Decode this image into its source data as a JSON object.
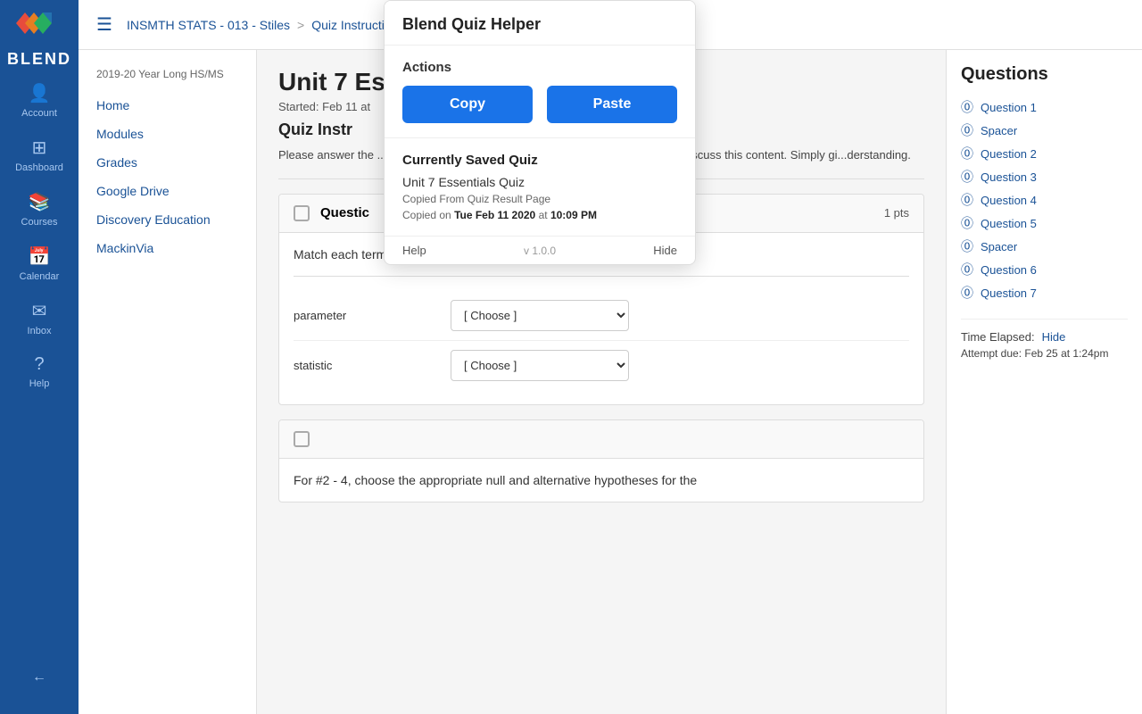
{
  "sidebar": {
    "logo_text": "BLEND",
    "items": [
      {
        "id": "account",
        "label": "Account",
        "icon": "👤"
      },
      {
        "id": "dashboard",
        "label": "Dashboard",
        "icon": "⊞"
      },
      {
        "id": "courses",
        "label": "Courses",
        "icon": "📚"
      },
      {
        "id": "calendar",
        "label": "Calendar",
        "icon": "📅"
      },
      {
        "id": "inbox",
        "label": "Inbox",
        "icon": "✉"
      },
      {
        "id": "help",
        "label": "Help",
        "icon": "?"
      }
    ],
    "collapse_icon": "←"
  },
  "topnav": {
    "breadcrumb_course": "INSMTH STATS - 013 - Stiles",
    "breadcrumb_sep": ">",
    "breadcrumb_current": "Quiz Instructions"
  },
  "left_nav": {
    "year_label": "2019-20 Year Long HS/MS",
    "links": [
      {
        "label": "Home"
      },
      {
        "label": "Modules"
      },
      {
        "label": "Grades"
      },
      {
        "label": "Google Drive"
      },
      {
        "label": "Discovery Education"
      },
      {
        "label": "MackinVia"
      }
    ]
  },
  "quiz": {
    "title": "Unit 7 Ess",
    "started": "Started: Feb 11 at",
    "instructions_title": "Quiz Instr",
    "instructions_text": "Please answer the ...eet, t-table and a calculator.\nI encourage you to ...roughly discuss this\ncontent.  Simply gi...derstanding."
  },
  "question1": {
    "label": "Questic",
    "pts": "1 pts",
    "text": "Match each term with its definition.",
    "rows": [
      {
        "term": "parameter",
        "placeholder": "[ Choose ]"
      },
      {
        "term": "statistic",
        "placeholder": "[ Choose ]"
      }
    ]
  },
  "question2": {
    "text": "For #2 - 4, choose the appropriate null and alternative hypotheses for the"
  },
  "right_panel": {
    "title": "Questions",
    "items": [
      {
        "label": "Question 1"
      },
      {
        "label": "Spacer"
      },
      {
        "label": "Question 2"
      },
      {
        "label": "Question 3"
      },
      {
        "label": "Question 4"
      },
      {
        "label": "Question 5"
      },
      {
        "label": "Spacer"
      },
      {
        "label": "Question 6"
      },
      {
        "label": "Question 7"
      }
    ],
    "time_elapsed_label": "Time Elapsed:",
    "hide_label": "Hide",
    "attempt_due": "Attempt due: Feb 25 at 1:24pm"
  },
  "quiz_helper": {
    "title": "Blend Quiz Helper",
    "actions_label": "Actions",
    "copy_btn": "Copy",
    "paste_btn": "Paste",
    "saved_quiz_title": "Currently Saved Quiz",
    "saved_quiz_name": "Unit 7 Essentials Quiz",
    "saved_quiz_source": "Copied From Quiz Result Page",
    "saved_quiz_date_prefix": "Copied on",
    "saved_quiz_date_bold": "Tue Feb 11 2020",
    "saved_quiz_date_at": "at",
    "saved_quiz_time_bold": "10:09 PM",
    "help_label": "Help",
    "version": "v 1.0.0",
    "hide_label": "Hide"
  }
}
